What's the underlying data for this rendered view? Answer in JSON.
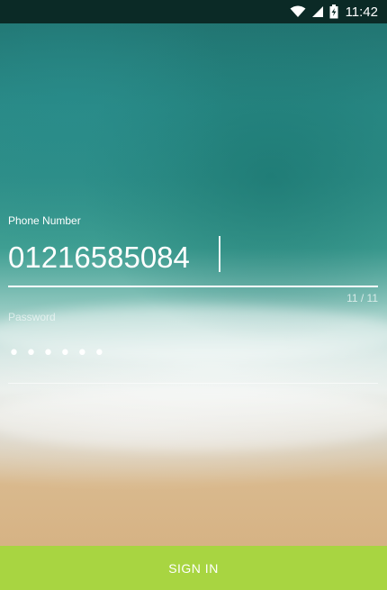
{
  "status_bar": {
    "time": "11:42",
    "icons": [
      "wifi-icon",
      "signal-icon",
      "battery-charging-icon"
    ]
  },
  "login_form": {
    "phone_label": "Phone Number",
    "phone_value": "01216585084",
    "phone_counter": "11 / 11",
    "password_label": "Password",
    "password_value": "123456"
  },
  "signin_button": {
    "label": "SIGN IN"
  },
  "colors": {
    "status_bar": "#0b2a26",
    "button": "#a8d541",
    "text": "#ffffff"
  }
}
